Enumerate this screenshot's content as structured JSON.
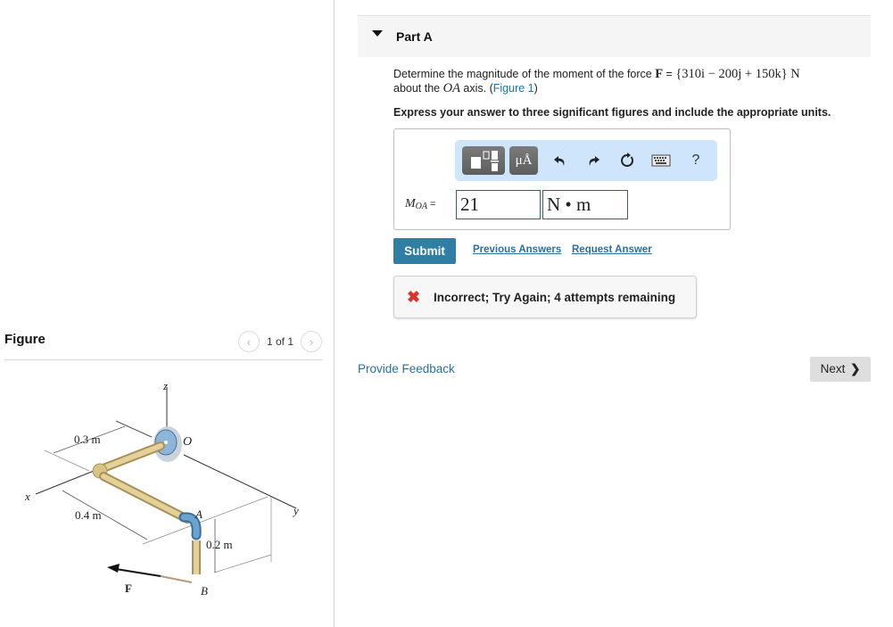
{
  "figure_panel": {
    "title": "Figure",
    "pager": {
      "prev_icon": "‹",
      "next_icon": "›",
      "current": 1,
      "total": 1,
      "label": "1 of 1"
    },
    "diagram": {
      "axis_labels": {
        "x": "x",
        "y": "y",
        "z": "z"
      },
      "point_labels": {
        "O": "O",
        "A": "A",
        "B": "B"
      },
      "force_label": "F",
      "dimensions": {
        "d1": "0.3 m",
        "d2": "0.4 m",
        "d3": "0.2 m"
      },
      "colors": {
        "pipe": "#d8c387",
        "pipe_dark": "#a8915a",
        "elbow_blue": "#6aa3cf",
        "flange": "#8fb6d9"
      }
    }
  },
  "part": {
    "title": "Part A",
    "question": {
      "prefix": "Determine the magnitude of the moment of the force ",
      "force_symbol": "F",
      "equals": " = ",
      "force_vector": "{310i − 200j + 150k} N",
      "line2_prefix": "about the ",
      "axis_name": "OA",
      "line2_suffix": " axis. (",
      "figure_link": "Figure 1",
      "line2_end": ")"
    },
    "instruction": "Express your answer to three significant figures and include the appropriate units.",
    "toolbar": {
      "template_icon": "templates-icon",
      "units_label": "μÅ",
      "undo_icon": "undo-icon",
      "redo_icon": "redo-icon",
      "reset_icon": "reset-icon",
      "keyboard_icon": "keyboard-icon",
      "help_label": "?"
    },
    "answer": {
      "label_main": "M",
      "label_sub": "OA",
      "label_eq": "=",
      "value": "21",
      "units": "N • m"
    },
    "submit_label": "Submit",
    "previous_answers_label": "Previous Answers",
    "request_answer_label": "Request Answer",
    "feedback": {
      "icon": "✖",
      "message": "Incorrect; Try Again; 4 attempts remaining",
      "color": "#d9342b"
    }
  },
  "footer": {
    "provide_feedback_label": "Provide Feedback",
    "next_label": "Next",
    "next_icon": "❯"
  }
}
